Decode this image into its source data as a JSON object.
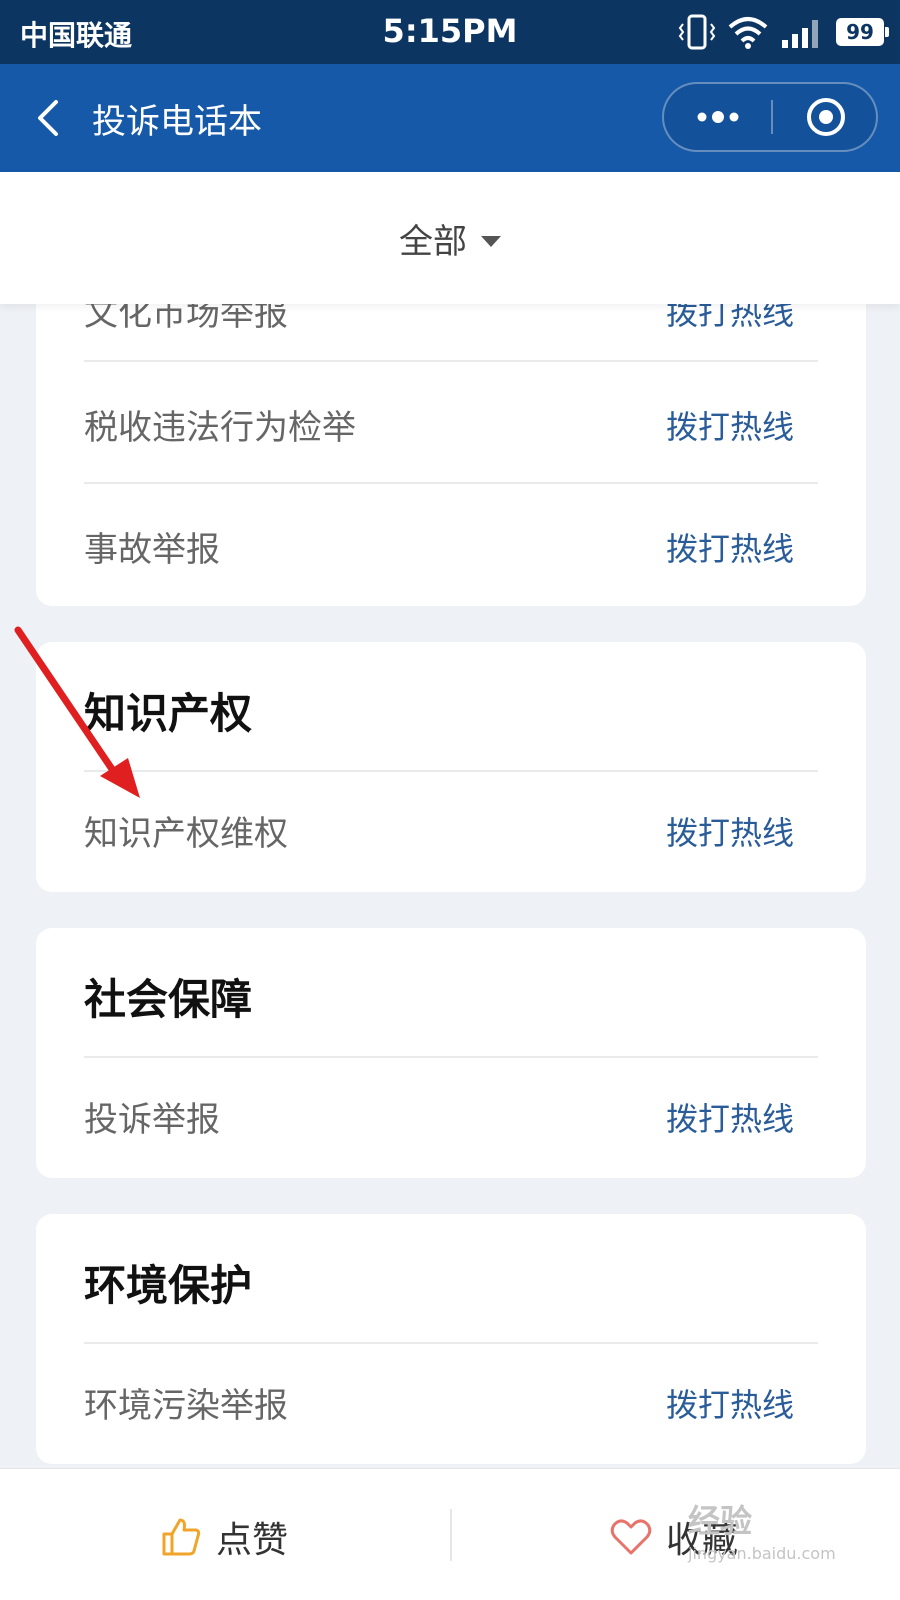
{
  "status_bar": {
    "carrier": "中国联通",
    "time": "5:15PM",
    "battery": "99"
  },
  "nav": {
    "title": "投诉电话本"
  },
  "filter": {
    "label": "全部"
  },
  "cards": [
    {
      "rows": [
        {
          "label": "文化市场举报",
          "action": "拨打热线"
        },
        {
          "label": "税收违法行为检举",
          "action": "拨打热线"
        },
        {
          "label": "事故举报",
          "action": "拨打热线"
        }
      ]
    },
    {
      "title": "知识产权",
      "rows": [
        {
          "label": "知识产权维权",
          "action": "拨打热线"
        }
      ]
    },
    {
      "title": "社会保障",
      "rows": [
        {
          "label": "投诉举报",
          "action": "拨打热线"
        }
      ]
    },
    {
      "title": "环境保护",
      "rows": [
        {
          "label": "环境污染举报",
          "action": "拨打热线"
        }
      ]
    }
  ],
  "bottom_bar": {
    "like_label": "点赞",
    "favorite_label": "收藏"
  },
  "watermark": {
    "text": "经验",
    "url": "jingyan.baidu.com"
  },
  "colors": {
    "nav": "#1559a8",
    "status": "#0d3562",
    "link": "#2a5c9a",
    "arrow": "#e02020"
  }
}
